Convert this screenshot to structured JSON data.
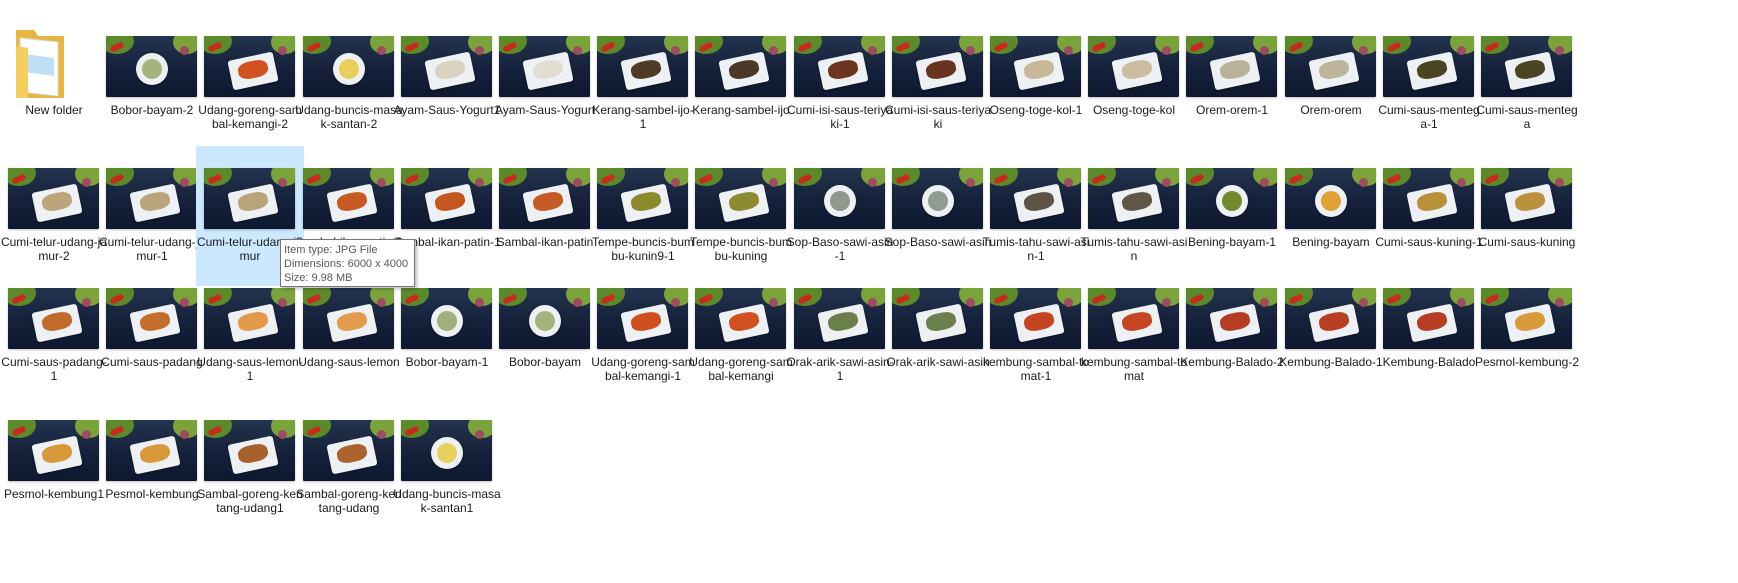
{
  "colors": {
    "selection": "#cce8ff",
    "label": "#1a1a1a",
    "tooltip_border": "#767676",
    "tooltip_text": "#575757"
  },
  "folder": {
    "label": "New folder",
    "icon": "folder-icon"
  },
  "files": [
    {
      "label": "Bobor-bayam-2",
      "food": "#a7b37c",
      "dish": "bowl"
    },
    {
      "label": "Udang-goreng-sambal-kemangi-2",
      "food": "#d2521f",
      "dish": "plate"
    },
    {
      "label": "Udang-buncis-masak-santan-2",
      "food": "#e7cf5a",
      "dish": "bowl"
    },
    {
      "label": "Ayam-Saus-Yogurt1",
      "food": "#d9d3c1",
      "dish": "plate"
    },
    {
      "label": "Ayam-Saus-Yogurt",
      "food": "#e1ddd0",
      "dish": "plate"
    },
    {
      "label": "Kerang-sambel-ijo-1",
      "food": "#4e3b25",
      "dish": "plate"
    },
    {
      "label": "Kerang-sambel-ijo",
      "food": "#4b3826",
      "dish": "plate"
    },
    {
      "label": "Cumi-isi-saus-teriyaki-1",
      "food": "#6c3520",
      "dish": "plate"
    },
    {
      "label": "Cumi-isi-saus-teriyaki",
      "food": "#6a3320",
      "dish": "plate"
    },
    {
      "label": "Oseng-toge-kol-1",
      "food": "#c9b79a",
      "dish": "plate"
    },
    {
      "label": "Oseng-toge-kol",
      "food": "#cbbca2",
      "dish": "plate"
    },
    {
      "label": "Orem-orem-1",
      "food": "#b8b29a",
      "dish": "plate"
    },
    {
      "label": "Orem-orem",
      "food": "#bdb49c",
      "dish": "plate"
    },
    {
      "label": "Cumi-saus-mentega-1",
      "food": "#4a4422",
      "dish": "plate"
    },
    {
      "label": "Cumi-saus-mentega",
      "food": "#4b4524",
      "dish": "plate"
    },
    {
      "label": "Cumi-telur-udang-jamur-2",
      "food": "#bca57a",
      "dish": "plate"
    },
    {
      "label": "Cumi-telur-udang-jamur-1",
      "food": "#b9a47b",
      "dish": "plate"
    },
    {
      "label": "Cumi-telur-udang-jamur",
      "food": "#b8a37a",
      "dish": "plate",
      "selected": true
    },
    {
      "label": "Sambal-ikan-patin-2",
      "food": "#c75a22",
      "dish": "plate"
    },
    {
      "label": "Sambal-ikan-patin-1",
      "food": "#c4571f",
      "dish": "plate"
    },
    {
      "label": "Sambal-ikan-patin",
      "food": "#c55a22",
      "dish": "plate"
    },
    {
      "label": "Tempe-buncis-bumbu-kunin9-1",
      "food": "#8a8a2c",
      "dish": "plate"
    },
    {
      "label": "Tempe-buncis-bumbu-kuning",
      "food": "#8c8b2f",
      "dish": "plate"
    },
    {
      "label": "Sop-Baso-sawi-asin-1",
      "food": "#8e9b8c",
      "dish": "bowl"
    },
    {
      "label": "Sop-Baso-sawi-asin",
      "food": "#909c8e",
      "dish": "bowl"
    },
    {
      "label": "Tumis-tahu-sawi-asin-1",
      "food": "#5d5446",
      "dish": "plate"
    },
    {
      "label": "Tumis-tahu-sawi-asin",
      "food": "#5f5648",
      "dish": "plate"
    },
    {
      "label": "Bening-bayam-1",
      "food": "#6f8a2a",
      "dish": "bowl"
    },
    {
      "label": "Bening-bayam",
      "food": "#e0a234",
      "dish": "bowl"
    },
    {
      "label": "Cumi-saus-kuning-1",
      "food": "#b98f3a",
      "dish": "plate"
    },
    {
      "label": "Cumi-saus-kuning",
      "food": "#ba913c",
      "dish": "plate"
    },
    {
      "label": "Cumi-saus-padang-1",
      "food": "#c16a2a",
      "dish": "plate"
    },
    {
      "label": "Cumi-saus-padang",
      "food": "#c56d2c",
      "dish": "plate"
    },
    {
      "label": "Udang-saus-lemon-1",
      "food": "#e29a4a",
      "dish": "plate"
    },
    {
      "label": "Udang-saus-lemon",
      "food": "#e49c4c",
      "dish": "plate"
    },
    {
      "label": "Bobor-bayam-1",
      "food": "#9fb07a",
      "dish": "bowl"
    },
    {
      "label": "Bobor-bayam",
      "food": "#a5b37c",
      "dish": "bowl"
    },
    {
      "label": "Udang-goreng-sambal-kemangi-1",
      "food": "#cf4f1e",
      "dish": "plate"
    },
    {
      "label": "Udang-goreng-sambal-kemangi",
      "food": "#d0501f",
      "dish": "plate"
    },
    {
      "label": "Orak-arik-sawi-asin-1",
      "food": "#6a7f4c",
      "dish": "plate"
    },
    {
      "label": "Orak-arik-sawi-asin",
      "food": "#6b804e",
      "dish": "plate"
    },
    {
      "label": "kembung-sambal-tomat-1",
      "food": "#c44322",
      "dish": "plate"
    },
    {
      "label": "kembung-sambal-tomat",
      "food": "#c54524",
      "dish": "plate"
    },
    {
      "label": "Kembung-Balado-2",
      "food": "#b63d22",
      "dish": "plate"
    },
    {
      "label": "Kembung-Balado-1",
      "food": "#b83f24",
      "dish": "plate"
    },
    {
      "label": "Kembung-Balado",
      "food": "#b63e23",
      "dish": "plate"
    },
    {
      "label": "Pesmol-kembung-2",
      "food": "#d89a3a",
      "dish": "plate"
    },
    {
      "label": "Pesmol-kembung1",
      "food": "#d69838",
      "dish": "plate"
    },
    {
      "label": "Pesmol-kembung",
      "food": "#d8993a",
      "dish": "plate"
    },
    {
      "label": "Sambal-goreng-kentang-udang1",
      "food": "#a9612c",
      "dish": "plate"
    },
    {
      "label": "Sambal-goreng-kentang-udang",
      "food": "#ab632e",
      "dish": "plate"
    },
    {
      "label": "Udang-buncis-masak-santan1",
      "food": "#e8d05c",
      "dish": "bowl"
    }
  ],
  "tooltip": {
    "type": "Item type: JPG File",
    "dimensions": "Dimensions: 6000 x 4000",
    "size": "Size: 9.98 MB"
  }
}
